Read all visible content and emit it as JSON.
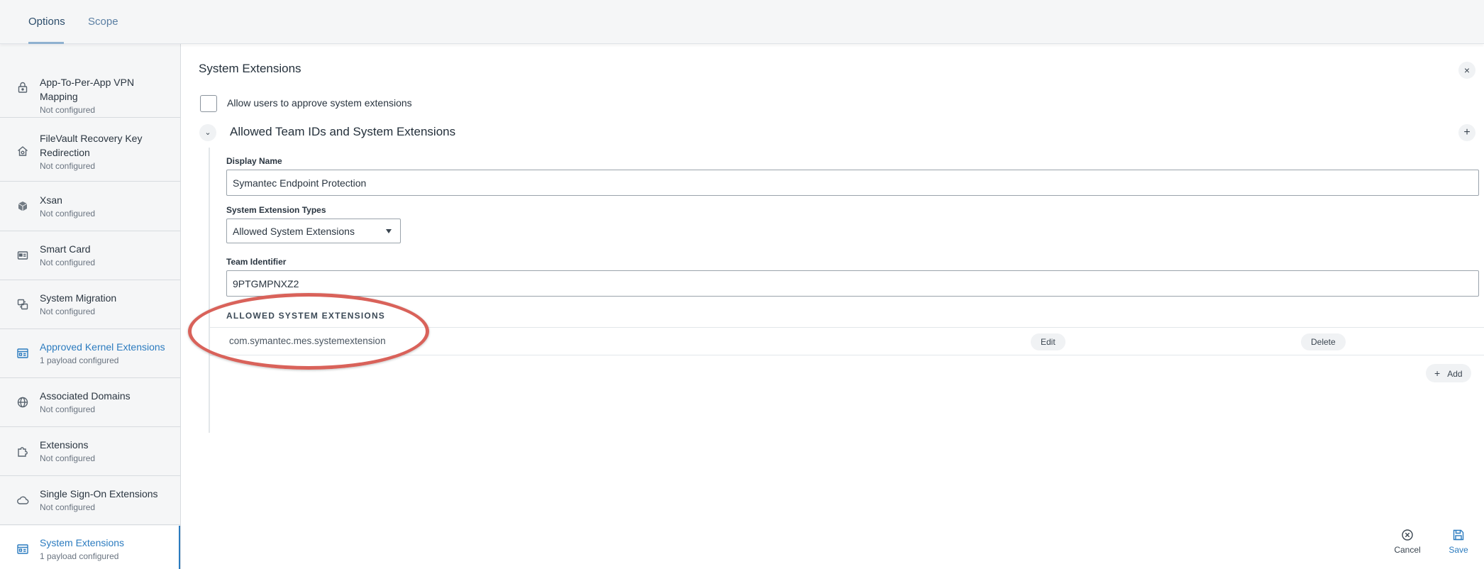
{
  "tabs": [
    {
      "label": "Options",
      "active": true
    },
    {
      "label": "Scope",
      "active": false
    }
  ],
  "sidebar": {
    "items": [
      {
        "title": "App-To-Per-App VPN Mapping",
        "subtitle": "Not configured",
        "icon": "lock-icon"
      },
      {
        "title": "FileVault Recovery Key Redirection",
        "subtitle": "Not configured",
        "icon": "house-icon"
      },
      {
        "title": "Xsan",
        "subtitle": "Not configured",
        "icon": "cube-icon"
      },
      {
        "title": "Smart Card",
        "subtitle": "Not configured",
        "icon": "card-reader-icon"
      },
      {
        "title": "System Migration",
        "subtitle": "Not configured",
        "icon": "migration-icon"
      },
      {
        "title": "Approved Kernel Extensions",
        "subtitle": "1 payload configured",
        "icon": "extension-window-icon"
      },
      {
        "title": "Associated Domains",
        "subtitle": "Not configured",
        "icon": "globe-icon"
      },
      {
        "title": "Extensions",
        "subtitle": "Not configured",
        "icon": "puzzle-icon"
      },
      {
        "title": "Single Sign-On Extensions",
        "subtitle": "Not configured",
        "icon": "cloud-icon"
      },
      {
        "title": "System Extensions",
        "subtitle": "1 payload configured",
        "icon": "extension-window-icon"
      }
    ]
  },
  "main": {
    "title": "System Extensions",
    "allow_users_label": "Allow users to approve system extensions",
    "section_title": "Allowed Team IDs and System Extensions",
    "display_name_label": "Display Name",
    "display_name_value": "Symantec Endpoint Protection",
    "ext_types_label": "System Extension Types",
    "ext_types_value": "Allowed System Extensions",
    "team_id_label": "Team Identifier",
    "team_id_value": "9PTGMPNXZ2",
    "allowed_header": "ALLOWED SYSTEM EXTENSIONS",
    "extensions": [
      {
        "name": "com.symantec.mes.systemextension",
        "edit_label": "Edit",
        "delete_label": "Delete"
      }
    ],
    "add_label": "Add"
  },
  "footer": {
    "cancel_label": "Cancel",
    "save_label": "Save"
  },
  "colors": {
    "accent": "#2b7bbf",
    "highlight": "#d9625a"
  }
}
